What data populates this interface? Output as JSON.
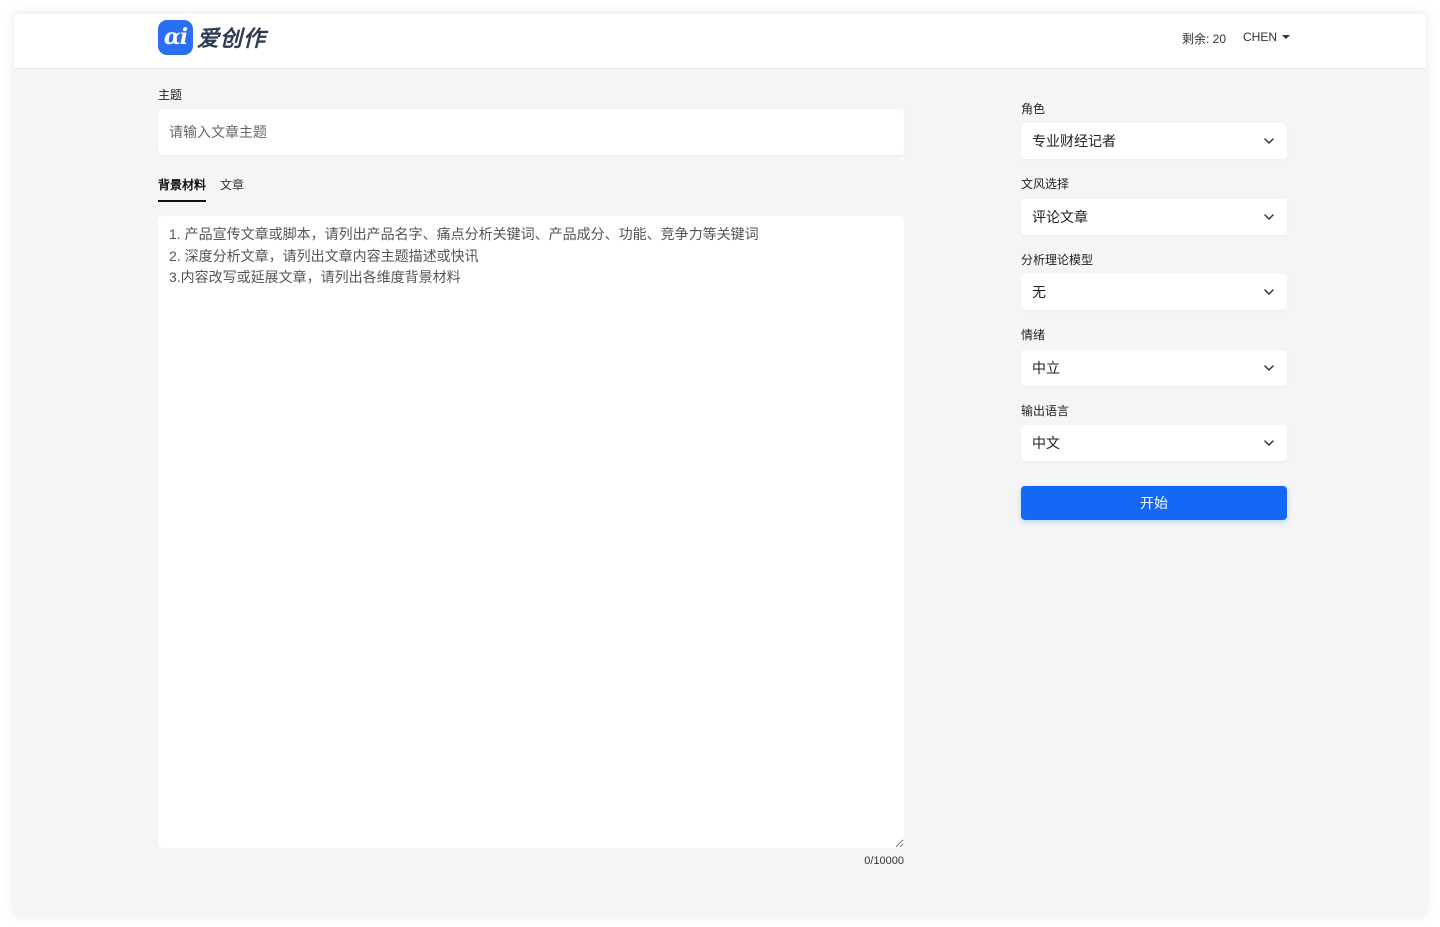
{
  "header": {
    "logo_mark": "αi",
    "logo_text": "爱创作",
    "credits_label": "剩余: 20",
    "user_name": "CHEN"
  },
  "main": {
    "topic": {
      "label": "主题",
      "value": "",
      "placeholder": "请输入文章主题"
    },
    "tabs": [
      {
        "label": "背景材料",
        "active": true
      },
      {
        "label": "文章",
        "active": false
      }
    ],
    "material": {
      "value": "",
      "placeholder": "1. 产品宣传文章或脚本，请列出产品名字、痛点分析关键词、产品成分、功能、竞争力等关键词\n2. 深度分析文章，请列出文章内容主题描述或快讯\n3.内容改写或延展文章，请列出各维度背景材料",
      "counter": "0/10000"
    }
  },
  "sidebar": {
    "fields": [
      {
        "label": "角色",
        "value": "专业财经记者"
      },
      {
        "label": "文风选择",
        "value": "评论文章"
      },
      {
        "label": "分析理论模型",
        "value": "无"
      },
      {
        "label": "情绪",
        "value": "中立"
      },
      {
        "label": "输出语言",
        "value": "中文"
      }
    ],
    "start_label": "开始"
  },
  "colors": {
    "primary": "#1568f6",
    "logo": "#2b6ef6",
    "background": "#f5f5f5"
  }
}
